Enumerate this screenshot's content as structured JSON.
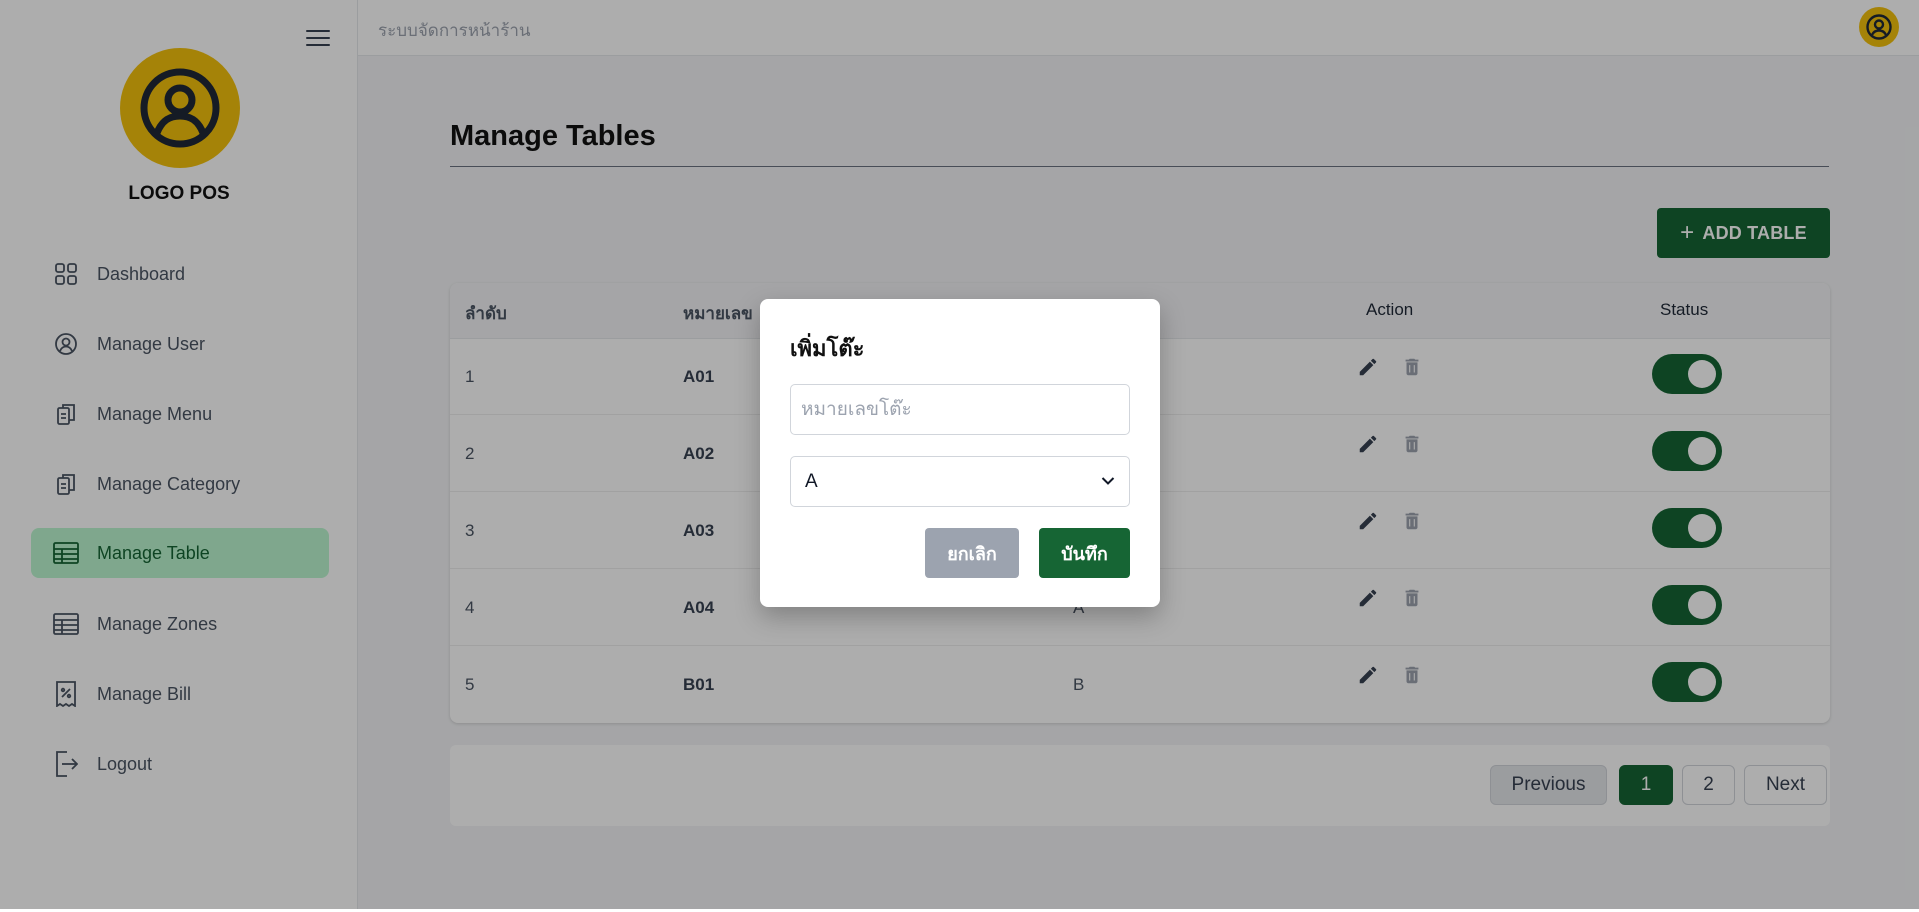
{
  "sidebar": {
    "logo_text": "LOGO POS",
    "items": [
      {
        "label": "Dashboard",
        "icon": "dashboard-grid-icon",
        "active": false
      },
      {
        "label": "Manage User",
        "icon": "user-circle-icon",
        "active": false
      },
      {
        "label": "Manage Menu",
        "icon": "clipboard-icon",
        "active": false
      },
      {
        "label": "Manage Category",
        "icon": "clipboard-icon",
        "active": false
      },
      {
        "label": "Manage Table",
        "icon": "table-icon",
        "active": true
      },
      {
        "label": "Manage Zones",
        "icon": "table-icon",
        "active": false
      },
      {
        "label": "Manage Bill",
        "icon": "receipt-icon",
        "active": false
      },
      {
        "label": "Logout",
        "icon": "logout-icon",
        "active": false
      }
    ]
  },
  "topbar": {
    "title": "ระบบจัดการหน้าร้าน"
  },
  "page": {
    "title": "Manage Tables",
    "add_button": "ADD TABLE"
  },
  "table": {
    "headers": {
      "order": "ลำดับ",
      "number": "หมายเลข",
      "action": "Action",
      "status": "Status"
    },
    "rows": [
      {
        "order": "1",
        "number": "A01",
        "zone": "",
        "status_on": true
      },
      {
        "order": "2",
        "number": "A02",
        "zone": "",
        "status_on": true
      },
      {
        "order": "3",
        "number": "A03",
        "zone": "",
        "status_on": true
      },
      {
        "order": "4",
        "number": "A04",
        "zone": "A",
        "status_on": true
      },
      {
        "order": "5",
        "number": "B01",
        "zone": "B",
        "status_on": true
      }
    ]
  },
  "pagination": {
    "previous": "Previous",
    "pages": [
      "1",
      "2"
    ],
    "current": "1",
    "next": "Next"
  },
  "modal": {
    "title": "เพิ่มโต๊ะ",
    "input_placeholder": "หมายเลขโต๊ะ",
    "input_value": "",
    "select_value": "A",
    "cancel": "ยกเลิก",
    "save": "บันทึก"
  },
  "colors": {
    "primary": "#166534",
    "active_nav_bg": "#bbf7d0",
    "logo_yellow": "#f4c20d",
    "cancel_gray": "#9ca3af"
  }
}
